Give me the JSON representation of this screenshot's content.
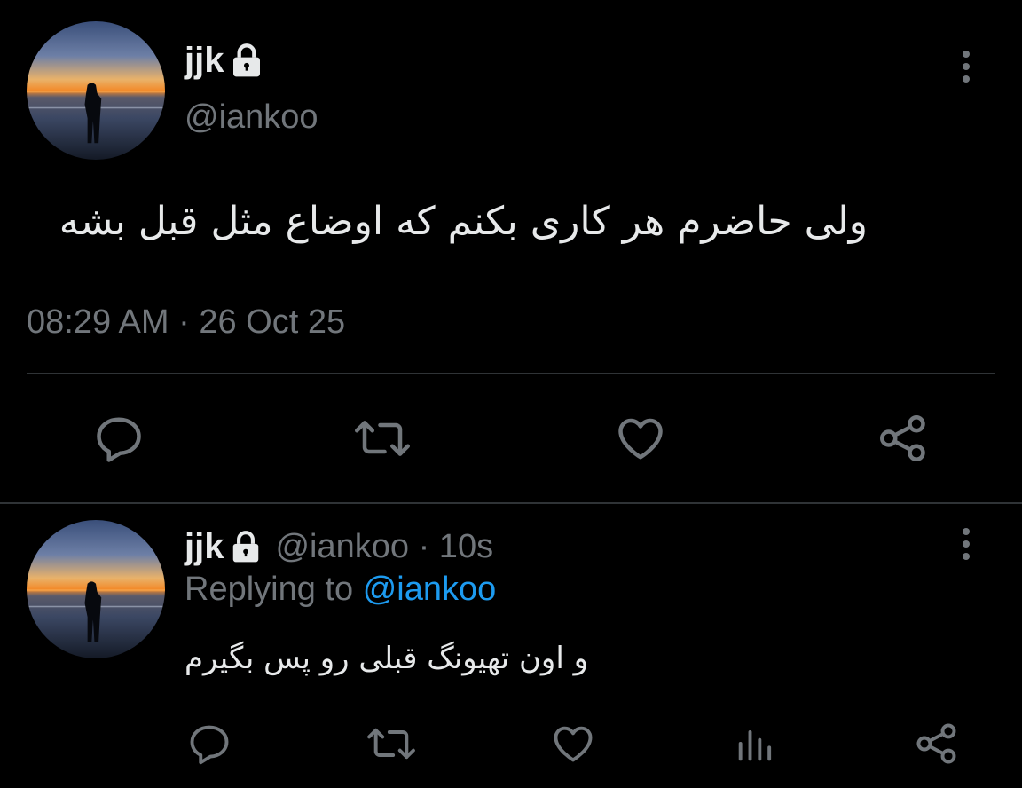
{
  "main_tweet": {
    "display_name": "jjk",
    "handle": "@iankoo",
    "text": "ولی حاضرم هر کاری بکنم که اوضاع مثل قبل بشه",
    "timestamp": "08:29 AM · 26 Oct 25",
    "actions": [
      "reply-icon",
      "retweet-icon",
      "like-icon",
      "share-icon"
    ]
  },
  "reply_tweet": {
    "display_name": "jjk",
    "handle_time": "@iankoo · 10s",
    "replying_prefix": "Replying to",
    "replying_handle": "@iankoo",
    "text": "و اون تهیونگ قبلی رو پس بگیرم",
    "actions": [
      "reply-icon",
      "retweet-icon",
      "like-icon",
      "analytics-icon",
      "share-icon"
    ]
  },
  "colors": {
    "background": "#000000",
    "text_primary": "#e7e9ea",
    "text_secondary": "#71767b",
    "link": "#1d9bf0",
    "icon": "#71767b",
    "divider": "#2f3336"
  }
}
